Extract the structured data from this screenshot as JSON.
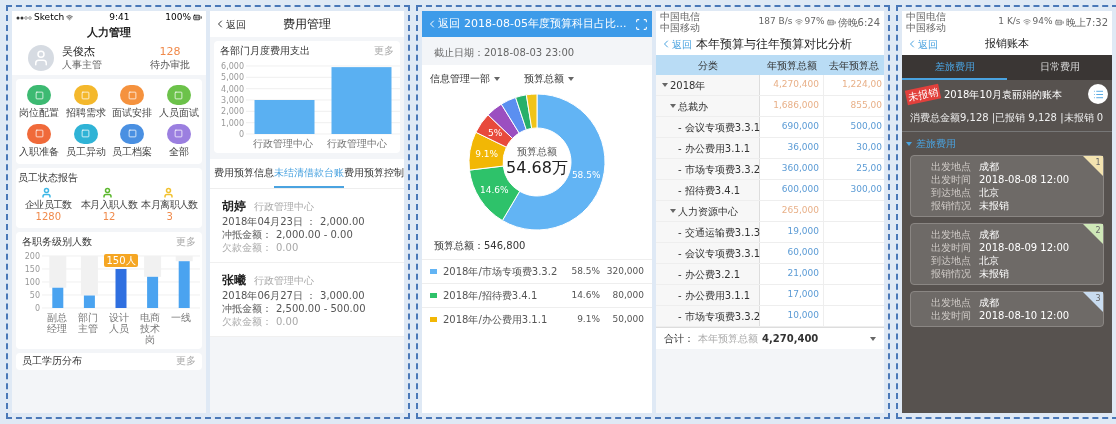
{
  "hr_app": {
    "status_bar": {
      "carrier": "Sketch",
      "time": "9:41",
      "battery": "100%"
    },
    "title": "人力管理",
    "profile": {
      "name": "吴俊杰",
      "role": "人事主管",
      "pending_count": "128",
      "pending_label": "待办审批"
    },
    "shortcuts": [
      {
        "label": "岗位配置",
        "color": "#3dba72"
      },
      {
        "label": "招聘需求",
        "color": "#f4b82c"
      },
      {
        "label": "面试安排",
        "color": "#f5923e"
      },
      {
        "label": "人员面试",
        "color": "#6cc24a"
      },
      {
        "label": "入职准备",
        "color": "#f06a3a"
      },
      {
        "label": "员工异动",
        "color": "#2fb3d6"
      },
      {
        "label": "员工档案",
        "color": "#4a90e2"
      },
      {
        "label": "全部",
        "color": "#9b7fe0"
      }
    ],
    "report": {
      "title": "员工状态报告",
      "stats": [
        {
          "label": "企业员工数",
          "value": "1280",
          "color": "#3fb8e6"
        },
        {
          "label": "本月入职人数",
          "value": "12",
          "color": "#5cb82e"
        },
        {
          "label": "本月离职人数",
          "value": "3",
          "color": "#f2c230"
        }
      ]
    },
    "position_chart": {
      "title": "各职务级别人数",
      "more": "更多",
      "chart_data": {
        "type": "bar",
        "categories": [
          "副总经理",
          "部门主管",
          "设计人员",
          "电商技术岗",
          "一线"
        ],
        "values": [
          78,
          48,
          150,
          120,
          180
        ],
        "ylim": [
          0,
          200
        ],
        "yticks": [
          0,
          50,
          100,
          150,
          200
        ],
        "grid": true,
        "annotations": [
          {
            "x": "设计人员",
            "y": 150,
            "text": "150人"
          }
        ]
      }
    },
    "next_section": {
      "title": "员工学历分布",
      "more": "更多"
    }
  },
  "expense_app": {
    "back": "返回",
    "title": "费用管理",
    "chart_card": {
      "title": "各部门月度费用支出",
      "more": "更多",
      "chart_data": {
        "type": "bar",
        "categories": [
          "行政管理中心",
          "行政管理中心"
        ],
        "values": [
          3000,
          5900
        ],
        "ylim": [
          0,
          6000
        ],
        "yticks": [
          {
            "value": 0,
            "label": "0"
          },
          {
            "value": 1000,
            "label": "1,000"
          },
          {
            "value": 2000,
            "label": "2,000"
          },
          {
            "value": 3000,
            "label": "3,000"
          },
          {
            "value": 4000,
            "label": "4,000"
          },
          {
            "value": 5000,
            "label": "5,000"
          },
          {
            "value": 6000,
            "label": "6,000"
          }
        ],
        "grid": true
      }
    },
    "tabs": [
      {
        "label": "费用预算信息",
        "selected": false
      },
      {
        "label": "未结清借款台账",
        "selected": true
      },
      {
        "label": "费用预算控制",
        "selected": false
      }
    ],
    "loans": [
      {
        "name": "胡婷",
        "department": "行政管理中心",
        "lines": [
          {
            "label": "2018年04月23日 ：",
            "value": "2,000.00",
            "muted": false
          },
          {
            "label": "冲抵金额：",
            "value": "2,000.00 - 0.00",
            "muted": false
          },
          {
            "label": "欠款金额：",
            "value": "0.00",
            "muted": true
          }
        ]
      },
      {
        "name": "张曦",
        "department": "行政管理中心",
        "lines": [
          {
            "label": "2018年06月27日 ：",
            "value": "3,000.00",
            "muted": false
          },
          {
            "label": "冲抵金额：",
            "value": "2,500.00 - 500.00",
            "muted": false
          },
          {
            "label": "欠款金额：",
            "value": "0.00",
            "muted": true
          }
        ]
      }
    ]
  },
  "budget_share_app": {
    "back": "返回",
    "title": "2018-08-05年度预算科目占比...",
    "deadline": "截止日期：2018-08-03 23:00",
    "filters": [
      "信息管理一部",
      "预算总额"
    ],
    "center_label": "预算总额",
    "center_value": "54.68万",
    "chart_data": {
      "type": "donut",
      "values": [
        58.5,
        14.6,
        9.1,
        5,
        4,
        3.7,
        2.6,
        2.5
      ],
      "colors": [
        "#62b4f4",
        "#2ec26a",
        "#f2b705",
        "#e84a3c",
        "#9b4fc0",
        "#5b8ff0",
        "#27b06a",
        "#f0c419"
      ],
      "data_labels": true,
      "value_labels": [
        "58.5%",
        "14.6%",
        "9.1%",
        "5%",
        null,
        null,
        null,
        null
      ]
    },
    "total": "预算总额：546,800",
    "legend": [
      {
        "label": "2018年/市场专项费3.3.2",
        "share": "58.5%",
        "amount": "320,000",
        "color": "#62b4f4"
      },
      {
        "label": "2018年/招待费3.4.1",
        "share": "14.6%",
        "amount": "80,000",
        "color": "#2ec26a"
      },
      {
        "label": "2018年/办公费用3.1.1",
        "share": "9.1%",
        "amount": "50,000",
        "color": "#f2b705"
      }
    ]
  },
  "budget_compare_app": {
    "status_bar": {
      "carriers": [
        "中国电信",
        "中国移动"
      ],
      "speed": "187 B/s",
      "battery": "97%",
      "time": "傍晚6:24"
    },
    "back": "返回",
    "title": "本年预算与往年预算对比分析",
    "columns": [
      "分类",
      "年预算总额",
      "去年预算总"
    ],
    "rows": [
      {
        "label": "2018年",
        "this_year": "4,270,400",
        "last_year": "1,224,00",
        "expanded": true,
        "children": [
          {
            "label": "总裁办",
            "this_year": "1,686,000",
            "last_year": "855,00",
            "expanded": true,
            "children": [
              {
                "label": "- 会议专项费3.3.1",
                "this_year": "690,000",
                "last_year": "500,00"
              },
              {
                "label": "- 办公费用3.1.1",
                "this_year": "36,000",
                "last_year": "30,00"
              },
              {
                "label": "- 市场专项费3.3.2",
                "this_year": "360,000",
                "last_year": "25,00"
              },
              {
                "label": "- 招待费3.4.1",
                "this_year": "600,000",
                "last_year": "300,00"
              }
            ]
          },
          {
            "label": "人力资源中心",
            "this_year": "265,000",
            "expanded": true,
            "children": [
              {
                "label": "- 交通运输费3.1.3",
                "this_year": "19,000"
              },
              {
                "label": "- 会议专项费3.3.1",
                "this_year": "60,000"
              },
              {
                "label": "- 办公费3.2.1",
                "this_year": "21,000"
              },
              {
                "label": "- 办公费用3.1.1",
                "this_year": "17,000"
              },
              {
                "label": "- 市场专项费3.3.2",
                "this_year": "10,000"
              }
            ]
          }
        ]
      }
    ],
    "footer": {
      "label": "合计：",
      "caption": "本年预算总额",
      "value": "4,270,400"
    }
  },
  "reimbursement_app": {
    "status_bar": {
      "carriers": [
        "中国电信",
        "中国移动"
      ],
      "speed": "1 K/s",
      "battery": "94%",
      "time": "晚上7:32"
    },
    "back": "返回",
    "title": "报销账本",
    "tabs": [
      {
        "label": "差旅费用",
        "selected": true
      },
      {
        "label": "日常费用",
        "selected": false
      }
    ],
    "ribbon": "未报销",
    "bill_title": "2018年10月袁丽娟的账本",
    "summary": "消费总金额9,128 |已报销 9,128 |未报销 0",
    "section": {
      "label": "差旅费用",
      "expanded": true
    },
    "trips": [
      {
        "number": "1",
        "color": "#f3e3b0",
        "fields": [
          {
            "label": "出发地点",
            "value": "成都"
          },
          {
            "label": "出发时间",
            "value": "2018-08-08 12:00"
          },
          {
            "label": "到达地点",
            "value": "北京"
          },
          {
            "label": "报销情况",
            "value": "未报销"
          }
        ]
      },
      {
        "number": "2",
        "color": "#cfe8b8",
        "fields": [
          {
            "label": "出发地点",
            "value": "成都"
          },
          {
            "label": "出发时间",
            "value": "2018-08-09 12:00"
          },
          {
            "label": "到达地点",
            "value": "北京"
          },
          {
            "label": "报销情况",
            "value": "未报销"
          }
        ]
      },
      {
        "number": "3",
        "color": "#c9dcf0",
        "fields": [
          {
            "label": "出发地点",
            "value": "成都"
          },
          {
            "label": "出发时间",
            "value": "2018-08-10 12:00"
          }
        ]
      }
    ]
  }
}
